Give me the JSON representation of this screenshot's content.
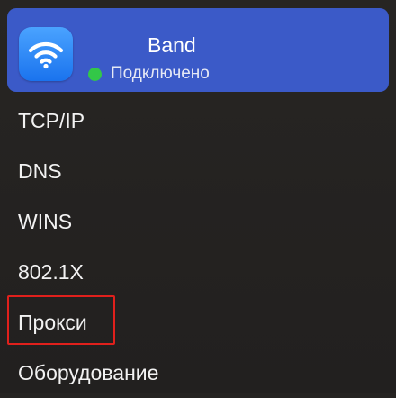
{
  "network": {
    "name": "Band",
    "status": "Подключено",
    "icon": "wifi-icon",
    "status_color": "#33c748",
    "card_color": "#3b5ac8"
  },
  "menu": {
    "items": [
      {
        "label": "TCP/IP"
      },
      {
        "label": "DNS"
      },
      {
        "label": "WINS"
      },
      {
        "label": "802.1X"
      },
      {
        "label": "Прокси",
        "highlighted": true
      },
      {
        "label": "Оборудование"
      }
    ]
  },
  "highlight_color": "#e0201c"
}
